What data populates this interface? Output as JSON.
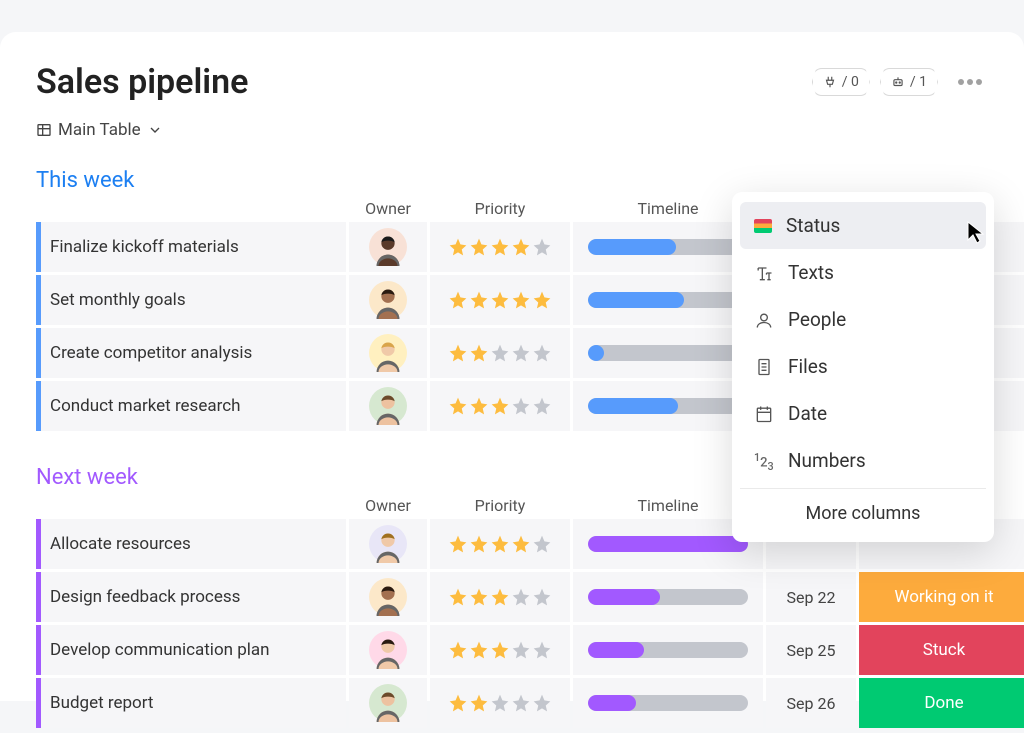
{
  "header": {
    "title": "Sales pipeline",
    "badge1_count": "/ 0",
    "badge2_count": "/ 1",
    "view_label": "Main Table"
  },
  "columns": {
    "owner": "Owner",
    "priority": "Priority",
    "timeline": "Timeline",
    "date": "",
    "status": ""
  },
  "groups": [
    {
      "name": "This week",
      "color": "blue",
      "rows": [
        {
          "task": "Finalize kickoff materials",
          "avatar": {
            "bg": "#f8e1d6",
            "hair": "#1a1a1a",
            "skin": "#5a3a2a"
          },
          "stars": 4,
          "progress": 55,
          "date": "",
          "status": null
        },
        {
          "task": "Set monthly goals",
          "avatar": {
            "bg": "#fce8c9",
            "hair": "#2a1a10",
            "skin": "#a37050"
          },
          "stars": 5,
          "progress": 60,
          "date": "",
          "status": null
        },
        {
          "task": "Create competitor analysis",
          "avatar": {
            "bg": "#fff0c0",
            "hair": "#d9a44a",
            "skin": "#f0c9a8"
          },
          "stars": 2,
          "progress": 10,
          "date": "",
          "status": null
        },
        {
          "task": "Conduct market research",
          "avatar": {
            "bg": "#d6e8d0",
            "hair": "#6b4a2a",
            "skin": "#edc2a0"
          },
          "stars": 3,
          "progress": 56,
          "date": "",
          "status": null
        }
      ]
    },
    {
      "name": "Next week",
      "color": "purple",
      "rows": [
        {
          "task": "Allocate resources",
          "avatar": {
            "bg": "#e8e6f7",
            "hair": "#a07020",
            "skin": "#f0c9a8"
          },
          "stars": 4,
          "progress": 100,
          "date": "",
          "status": null
        },
        {
          "task": "Design feedback process",
          "avatar": {
            "bg": "#fce8c9",
            "hair": "#2a1a10",
            "skin": "#a37050"
          },
          "stars": 3,
          "progress": 45,
          "date": "Sep 22",
          "status": {
            "label": "Working on it",
            "color": "#fdab3d"
          }
        },
        {
          "task": "Develop communication plan",
          "avatar": {
            "bg": "#ffd9e8",
            "hair": "#2a1a10",
            "skin": "#f0c9a8"
          },
          "stars": 3,
          "progress": 35,
          "date": "Sep 25",
          "status": {
            "label": "Stuck",
            "color": "#e2445c"
          }
        },
        {
          "task": "Budget report",
          "avatar": {
            "bg": "#d6e8d0",
            "hair": "#6b4a2a",
            "skin": "#edc2a0"
          },
          "stars": 2,
          "progress": 30,
          "date": "Sep 26",
          "status": {
            "label": "Done",
            "color": "#00ca72"
          }
        }
      ]
    }
  ],
  "dropdown": {
    "items": [
      {
        "label": "Status",
        "icon": "status"
      },
      {
        "label": "Texts",
        "icon": "text"
      },
      {
        "label": "People",
        "icon": "people"
      },
      {
        "label": "Files",
        "icon": "files"
      },
      {
        "label": "Date",
        "icon": "date"
      },
      {
        "label": "Numbers",
        "icon": "numbers"
      }
    ],
    "footer": "More columns"
  }
}
